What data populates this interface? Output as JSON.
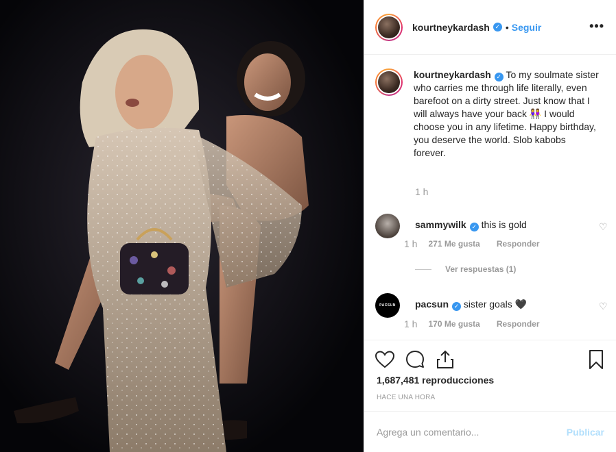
{
  "post": {
    "author": "kourtneykardash",
    "follow_label": "Seguir",
    "separator": "•",
    "more_label": "•••"
  },
  "caption": {
    "author": "kourtneykardash",
    "text": "To my soulmate sister who carries me through life literally, even barefoot on a dirty street. Just know that I will always have your back 👭 I would choose you in any lifetime. Happy birthday, you deserve the world. Slob kabobs forever.",
    "time": "1 h"
  },
  "comments": [
    {
      "author": "sammywilk",
      "text": "this is gold",
      "time": "1 h",
      "likes": "271 Me gusta",
      "reply_label": "Responder"
    },
    {
      "author": "pacsun",
      "text": "sister goals 🖤",
      "time": "1 h",
      "likes": "170 Me gusta",
      "reply_label": "Responder",
      "avatar_text": "PACSUN"
    }
  ],
  "replies_label": "Ver respuestas (1)",
  "stats": {
    "views": "1,687,481 reproducciones",
    "posted": "HACE UNA HORA"
  },
  "add_comment": {
    "placeholder": "Agrega un comentario...",
    "publish_label": "Publicar"
  },
  "colors": {
    "link": "#3897f0",
    "muted": "#999999",
    "publish_disabled": "#b2dffc"
  },
  "icons": {
    "verified": "verified-badge-icon",
    "like": "heart-icon",
    "comment": "comment-bubble-icon",
    "share": "share-icon",
    "save": "bookmark-icon"
  }
}
